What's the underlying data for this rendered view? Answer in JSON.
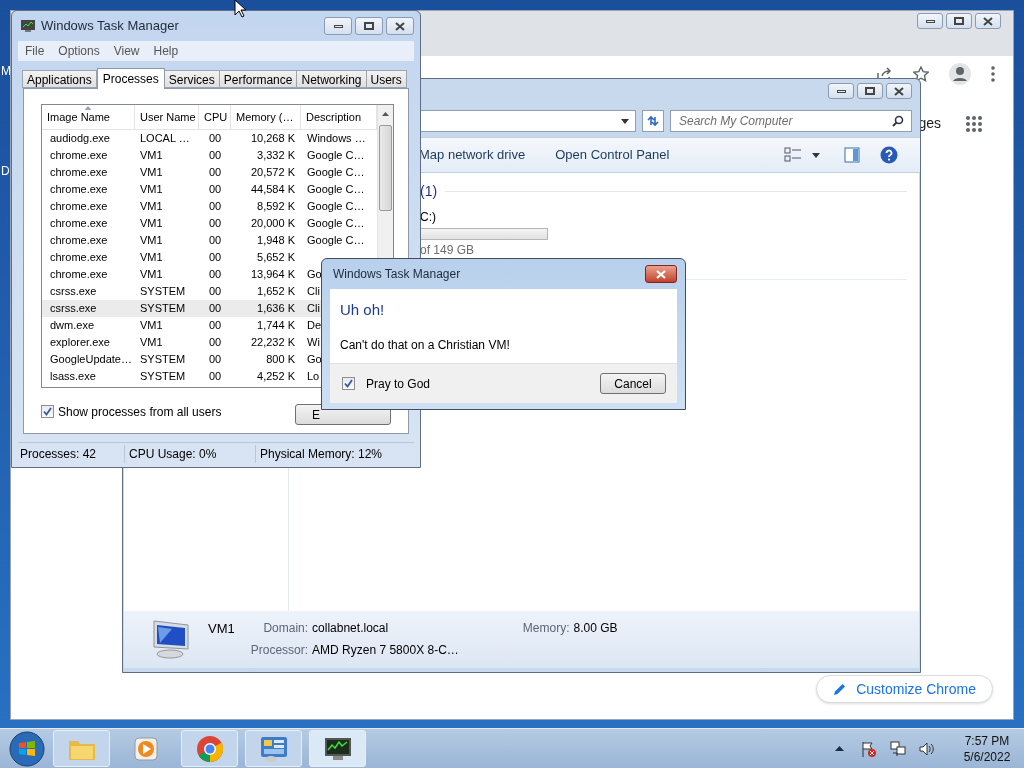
{
  "desktop": {
    "icon_labels": [
      "M",
      "D"
    ]
  },
  "browser": {
    "link_fragment": "ges",
    "customize_button": "Customize Chrome"
  },
  "explorer": {
    "search": {
      "placeholder": "Search My Computer"
    },
    "toolbar": [
      "Map network drive",
      "Open Control Panel"
    ],
    "group_header": "(1)",
    "drive": {
      "name": "C:)",
      "free": "of 149 GB"
    },
    "details": {
      "name": "VM1",
      "fields": [
        {
          "label": "Domain:",
          "value": "collabnet.local"
        },
        {
          "label": "Memory:",
          "value": "8.00 GB"
        },
        {
          "label": "Processor:",
          "value": "AMD Ryzen 7 5800X 8-C…"
        }
      ]
    }
  },
  "task_manager": {
    "title": "Windows Task Manager",
    "menu": [
      "File",
      "Options",
      "View",
      "Help"
    ],
    "tabs": [
      {
        "label": "Applications",
        "selected": false
      },
      {
        "label": "Processes",
        "selected": true
      },
      {
        "label": "Services",
        "selected": false
      },
      {
        "label": "Performance",
        "selected": false
      },
      {
        "label": "Networking",
        "selected": false
      },
      {
        "label": "Users",
        "selected": false
      }
    ],
    "columns": [
      {
        "label": "Image Name",
        "sorted": true
      },
      {
        "label": "User Name",
        "sorted": false
      },
      {
        "label": "CPU",
        "sorted": false
      },
      {
        "label": "Memory (…",
        "sorted": false
      },
      {
        "label": "Description",
        "sorted": false
      }
    ],
    "rows": [
      {
        "cells": [
          "audiodg.exe",
          "LOCAL …",
          "00",
          "10,268 K",
          "Windows …"
        ],
        "selected": false
      },
      {
        "cells": [
          "chrome.exe",
          "VM1",
          "00",
          "3,332 K",
          "Google C…"
        ],
        "selected": false
      },
      {
        "cells": [
          "chrome.exe",
          "VM1",
          "00",
          "20,572 K",
          "Google C…"
        ],
        "selected": false
      },
      {
        "cells": [
          "chrome.exe",
          "VM1",
          "00",
          "44,584 K",
          "Google C…"
        ],
        "selected": false
      },
      {
        "cells": [
          "chrome.exe",
          "VM1",
          "00",
          "8,592 K",
          "Google C…"
        ],
        "selected": false
      },
      {
        "cells": [
          "chrome.exe",
          "VM1",
          "00",
          "20,000 K",
          "Google C…"
        ],
        "selected": false
      },
      {
        "cells": [
          "chrome.exe",
          "VM1",
          "00",
          "1,948 K",
          "Google C…"
        ],
        "selected": false
      },
      {
        "cells": [
          "chrome.exe",
          "VM1",
          "00",
          "5,652 K"
        ],
        "selected": false
      },
      {
        "cells": [
          "chrome.exe",
          "VM1",
          "00",
          "13,964 K",
          "Go"
        ],
        "selected": false
      },
      {
        "cells": [
          "csrss.exe",
          "SYSTEM",
          "00",
          "1,652 K",
          "Cli"
        ],
        "selected": false
      },
      {
        "cells": [
          "csrss.exe",
          "SYSTEM",
          "00",
          "1,636 K",
          "Cli"
        ],
        "selected": true
      },
      {
        "cells": [
          "dwm.exe",
          "VM1",
          "00",
          "1,744 K",
          "De"
        ],
        "selected": false
      },
      {
        "cells": [
          "explorer.exe",
          "VM1",
          "00",
          "22,232 K",
          "Wi"
        ],
        "selected": false
      },
      {
        "cells": [
          "GoogleUpdate…",
          "SYSTEM",
          "00",
          "800 K",
          "Go"
        ],
        "selected": false
      },
      {
        "cells": [
          "lsass.exe",
          "SYSTEM",
          "00",
          "4,252 K",
          "Lo"
        ],
        "selected": false
      }
    ],
    "show_all_users": {
      "label": "Show processes from all users",
      "checked": true
    },
    "end_button": "E",
    "status": [
      "Processes: 42",
      "CPU Usage: 0%",
      "Physical Memory: 12%"
    ]
  },
  "dialog": {
    "title": "Windows Task Manager",
    "heading": "Uh oh!",
    "message": "Can't do that on a Christian VM!",
    "checkbox": {
      "label": "Pray to God",
      "checked": true
    },
    "button": "Cancel"
  },
  "taskbar": {
    "apps": [
      {
        "kind": "folder",
        "running": true,
        "active": false
      },
      {
        "kind": "media",
        "running": false,
        "active": false
      },
      {
        "kind": "chrome",
        "running": true,
        "active": false
      },
      {
        "kind": "control",
        "running": true,
        "active": false
      },
      {
        "kind": "taskmgr",
        "running": true,
        "active": true
      }
    ],
    "time": "7:57 PM",
    "date": "5/6/2022"
  }
}
